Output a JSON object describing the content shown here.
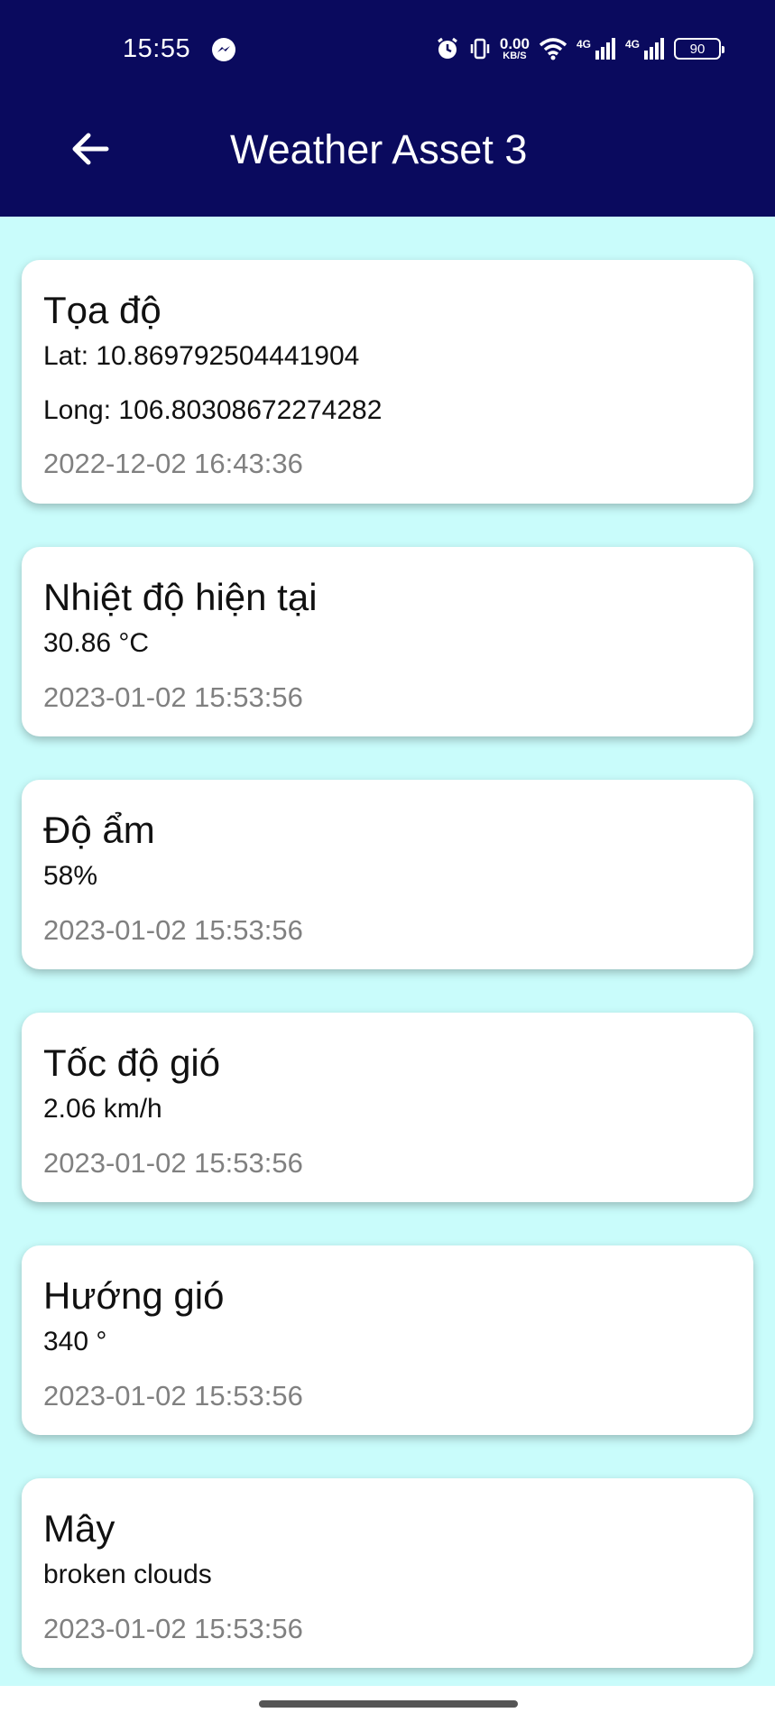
{
  "status_bar": {
    "time": "15:55",
    "net_speed_value": "0.00",
    "net_speed_unit": "KB/S",
    "signal1_label": "4G",
    "signal2_label": "4G",
    "battery": "90"
  },
  "header": {
    "title": "Weather Asset 3",
    "background": "#0a0a5e"
  },
  "page": {
    "background": "#c9fcfb"
  },
  "cards": [
    {
      "title": "Tọa độ",
      "line1": "Lat: 10.869792504441904",
      "line2": "Long: 106.80308672274282",
      "time": "2022-12-02 16:43:36"
    },
    {
      "title": "Nhiệt độ hiện tại",
      "line1": "30.86 °C",
      "time": "2023-01-02 15:53:56"
    },
    {
      "title": "Độ ẩm",
      "line1": "58%",
      "time": "2023-01-02 15:53:56"
    },
    {
      "title": "Tốc độ gió",
      "line1": "2.06 km/h",
      "time": "2023-01-02 15:53:56"
    },
    {
      "title": "Hướng gió",
      "line1": "340 °",
      "time": "2023-01-02 15:53:56"
    },
    {
      "title": "Mây",
      "line1": "broken clouds",
      "time": "2023-01-02 15:53:56"
    }
  ]
}
